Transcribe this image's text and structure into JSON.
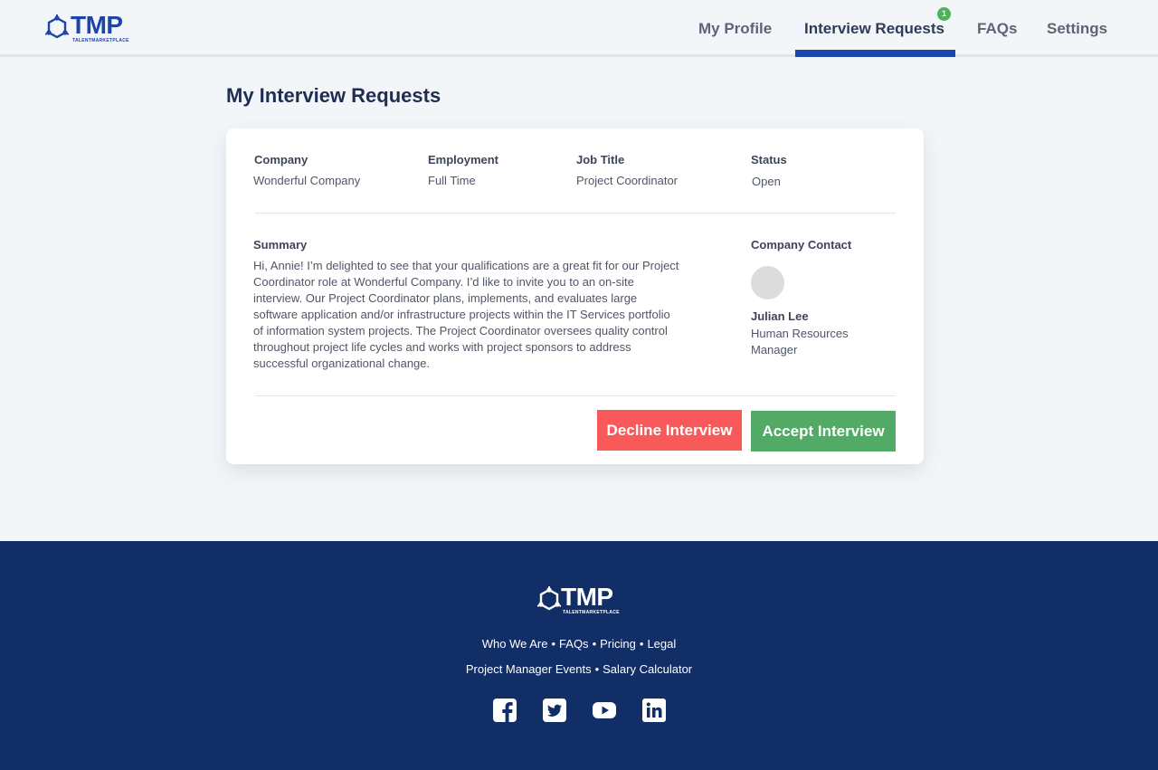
{
  "brand": {
    "name": "TMP",
    "tagline": "TALENTMARKETPLACE",
    "primary_color": "#1d44a8",
    "footer_bg": "#122e66"
  },
  "nav": {
    "items": [
      {
        "label": "My Profile",
        "active": false
      },
      {
        "label": "Interview Requests",
        "active": true
      },
      {
        "label": "FAQs",
        "active": false
      },
      {
        "label": "Settings",
        "active": false
      }
    ],
    "badge_count": "1"
  },
  "page": {
    "title": "My Interview Requests"
  },
  "request": {
    "company_label": "Company",
    "company": "Wonderful Company",
    "employment_label": "Employment",
    "employment": "Full Time",
    "job_title_label": "Job Title",
    "job_title": "Project Coordinator",
    "status_label": "Status",
    "status": "Open",
    "summary_label": "Summary",
    "summary": "Hi, Annie! I’m delighted to see that your qualifications are a great fit for our Project Coordinator role at Wonderful Company. I’d like to invite you to an on-site interview. Our Project Coordinator plans, implements, and evaluates large software application and/or infrastructure projects within the IT Services portfolio of information system projects. The Project Coordinator oversees quality control throughout project life cycles and works with project sponsors to address successful organizational change.",
    "contact_label": "Company Contact",
    "contact_name": "Julian Lee",
    "contact_role": "Human Resources Manager",
    "decline_label": "Decline Interview",
    "accept_label": "Accept Interview",
    "decline_color": "#f85a5a",
    "accept_color": "#53aa66"
  },
  "footer": {
    "links_row1": [
      "Who We Are",
      "FAQs",
      "Pricing",
      "Legal"
    ],
    "links_row2": [
      "Project Manager Events",
      "Salary Calculator"
    ],
    "social": [
      "facebook-icon",
      "twitter-icon",
      "youtube-icon",
      "linkedin-icon"
    ]
  }
}
